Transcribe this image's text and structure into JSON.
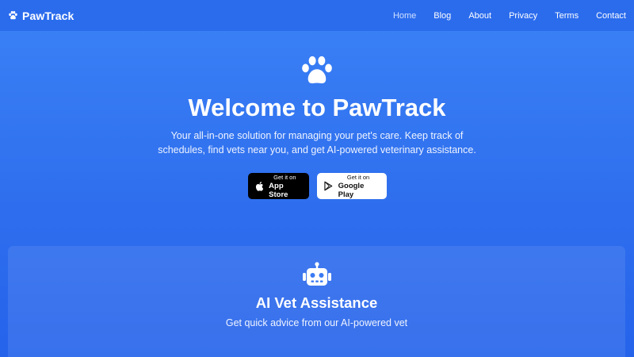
{
  "brand": {
    "name": "PawTrack",
    "icon": "paw-icon"
  },
  "nav": {
    "links": [
      {
        "label": "Home",
        "active": true
      },
      {
        "label": "Blog",
        "active": false
      },
      {
        "label": "About",
        "active": false
      },
      {
        "label": "Privacy",
        "active": false
      },
      {
        "label": "Terms",
        "active": false
      },
      {
        "label": "Contact",
        "active": false
      }
    ]
  },
  "hero": {
    "icon": "paw-icon",
    "title": "Welcome to PawTrack",
    "subtitle": "Your all-in-one solution for managing your pet's care. Keep track of schedules, find vets near you, and get AI-powered veterinary assistance."
  },
  "stores": {
    "apple": {
      "small": "Get it on",
      "big": "App Store",
      "icon": "apple-icon"
    },
    "google": {
      "small": "Get it on",
      "big": "Google Play",
      "icon": "play-store-icon"
    }
  },
  "feature": {
    "icon": "robot-icon",
    "title": "AI Vet Assistance",
    "description": "Get quick advice from our AI-powered vet"
  },
  "colors": {
    "background": "#3b82f6",
    "nav_background": "#2b6ced",
    "active_link": "#cfe0ff",
    "text": "#ffffff"
  }
}
